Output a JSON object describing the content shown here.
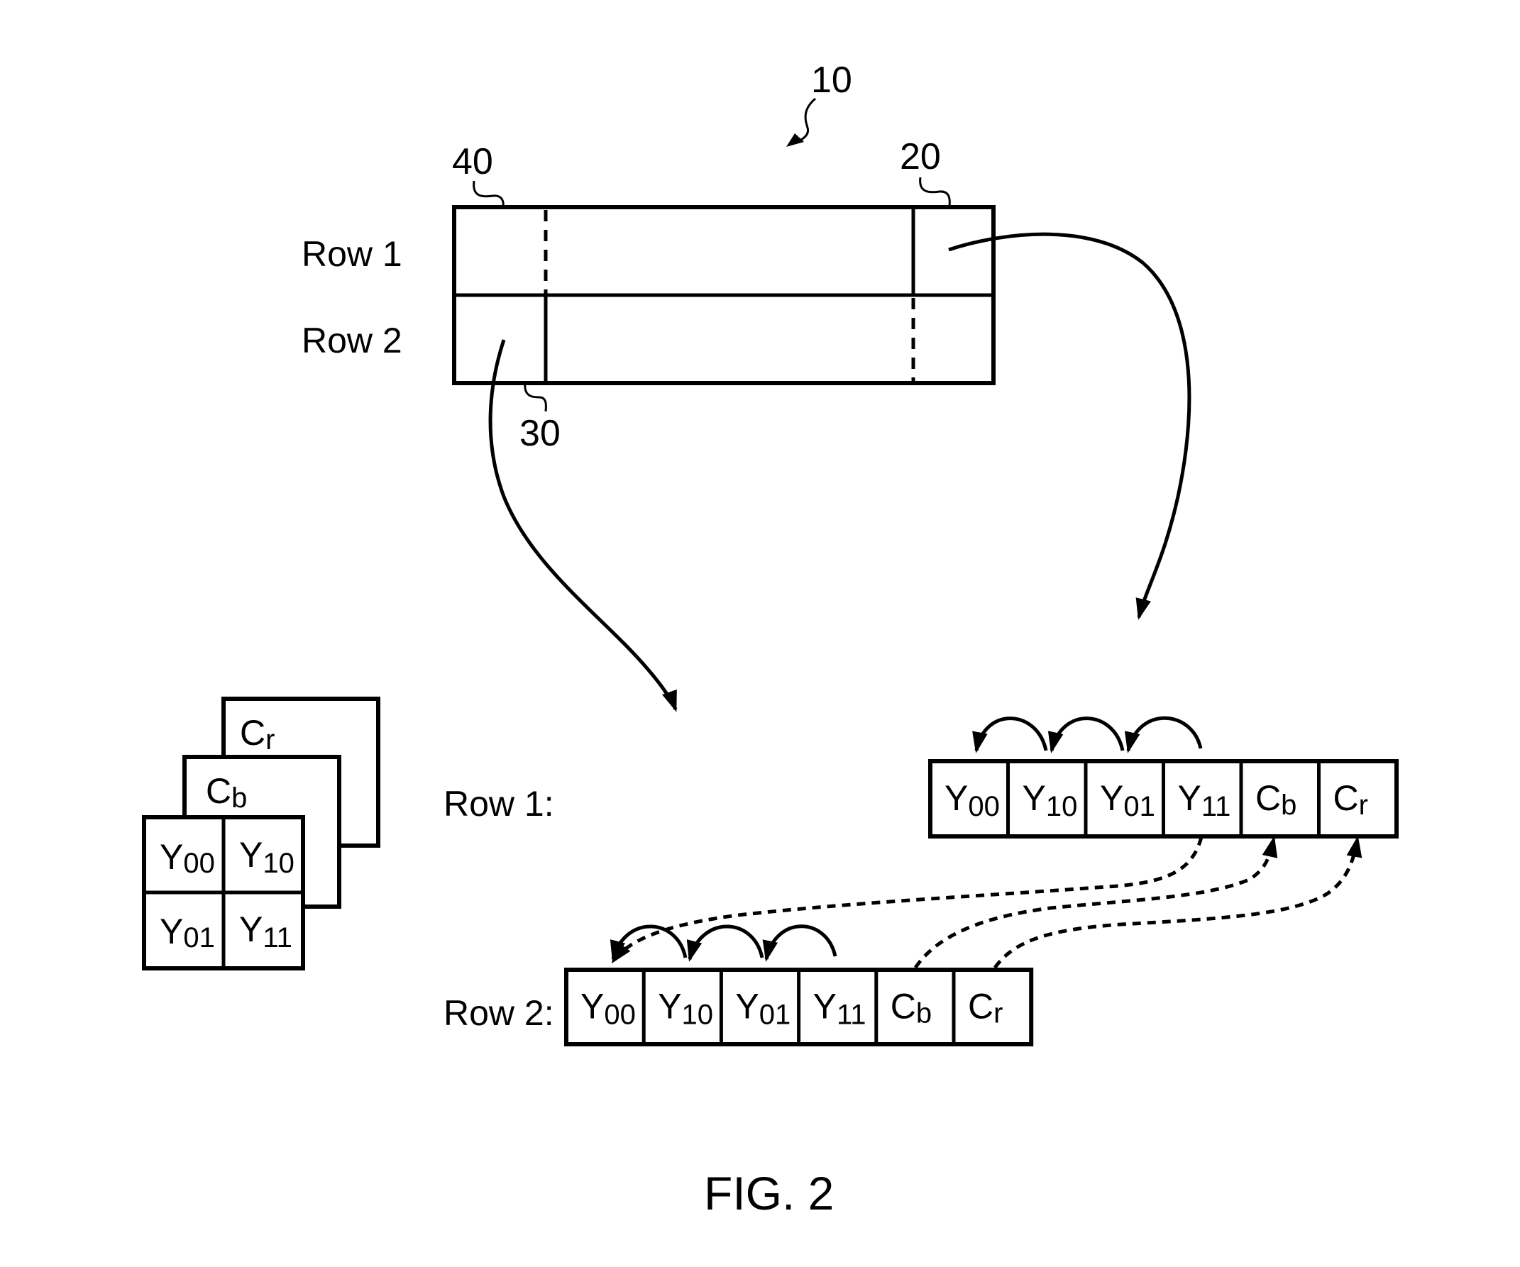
{
  "figure": {
    "caption": "FIG. 2",
    "reference_numerals": {
      "overall": "10",
      "first_region": "20",
      "second_region": "30",
      "third_region": "40"
    },
    "frame_row_labels": [
      "Row 1",
      "Row 2"
    ],
    "plane_stack": {
      "back_plane": {
        "main": "C",
        "sub": "r"
      },
      "middle_plane": {
        "main": "C",
        "sub": "b"
      },
      "luma_block": [
        {
          "main": "Y",
          "sub": "00"
        },
        {
          "main": "Y",
          "sub": "10"
        },
        {
          "main": "Y",
          "sub": "01"
        },
        {
          "main": "Y",
          "sub": "11"
        }
      ]
    },
    "sequences": [
      {
        "label": "Row 1:",
        "cells": [
          {
            "main": "Y",
            "sub": "00"
          },
          {
            "main": "Y",
            "sub": "10"
          },
          {
            "main": "Y",
            "sub": "01"
          },
          {
            "main": "Y",
            "sub": "11"
          },
          {
            "main": "C",
            "sub": "b"
          },
          {
            "main": "C",
            "sub": "r"
          }
        ]
      },
      {
        "label": "Row 2:",
        "cells": [
          {
            "main": "Y",
            "sub": "00"
          },
          {
            "main": "Y",
            "sub": "10"
          },
          {
            "main": "Y",
            "sub": "01"
          },
          {
            "main": "Y",
            "sub": "11"
          },
          {
            "main": "C",
            "sub": "b"
          },
          {
            "main": "C",
            "sub": "r"
          }
        ]
      }
    ]
  }
}
